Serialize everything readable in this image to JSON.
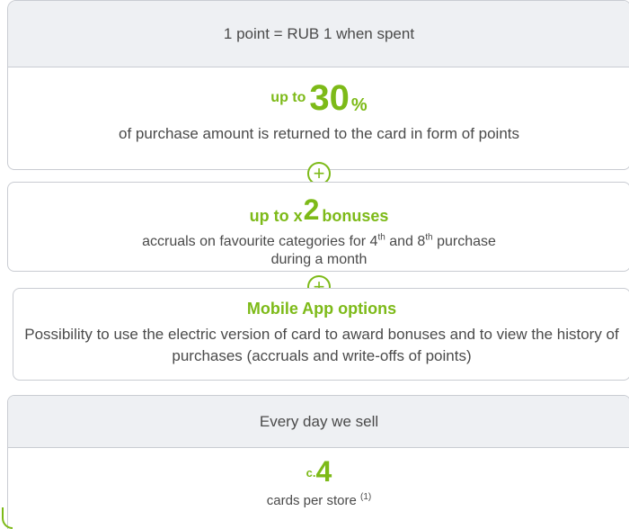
{
  "box1": {
    "header": "1 point = RUB 1 when spent",
    "prefix": "up to",
    "value": "30",
    "unit": "%",
    "description": "of purchase amount is returned to the card in form of points"
  },
  "box2": {
    "prefix": "up to x",
    "value": "2",
    "suffix": "bonuses",
    "desc_before": "accruals on favourite categories for 4",
    "sup1": "th",
    "desc_mid": " and 8",
    "sup2": "th",
    "desc_after": " purchase",
    "desc_line2": "during a month"
  },
  "box3": {
    "title": "Mobile App options",
    "description": "Possibility to use the electric version of card to award bonuses and to view the history of purchases (accruals and write-offs of points)"
  },
  "box4": {
    "header": "Every day we sell",
    "prefix": "c.",
    "value": "4",
    "description": "cards per store",
    "footnote": "(1)"
  },
  "plus_symbol": "+",
  "colors": {
    "accent": "#7dba18",
    "border": "#c9ccd2",
    "band": "#eef0f3",
    "text": "#4a4a4a"
  }
}
